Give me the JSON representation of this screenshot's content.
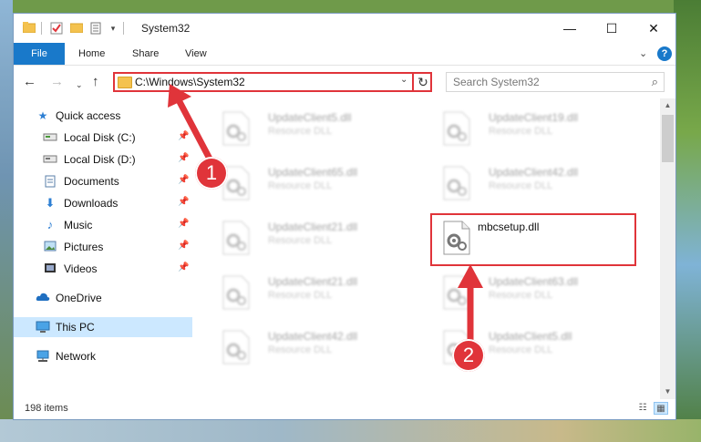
{
  "window": {
    "title": "System32",
    "controls": {
      "minimize": "—",
      "maximize": "☐",
      "close": "✕"
    },
    "quick_access_toolbar": [
      "folder-icon",
      "checklist-icon",
      "folder-icon",
      "properties-icon",
      "dropdown-icon"
    ]
  },
  "ribbon": {
    "file": "File",
    "tabs": [
      "Home",
      "Share",
      "View"
    ],
    "help": "?"
  },
  "navbar": {
    "address": "C:\\Windows\\System32",
    "search_placeholder": "Search System32"
  },
  "sidebar": {
    "items": [
      {
        "label": "Quick access",
        "icon": "star-icon"
      },
      {
        "label": "Local Disk (C:)",
        "icon": "drive-icon"
      },
      {
        "label": "Local Disk (D:)",
        "icon": "drive-icon"
      },
      {
        "label": "Documents",
        "icon": "documents-icon"
      },
      {
        "label": "Downloads",
        "icon": "download-icon"
      },
      {
        "label": "Music",
        "icon": "music-icon"
      },
      {
        "label": "Pictures",
        "icon": "pictures-icon"
      },
      {
        "label": "Videos",
        "icon": "videos-icon"
      },
      {
        "label": "OneDrive",
        "icon": "cloud-icon"
      },
      {
        "label": "This PC",
        "icon": "computer-icon",
        "selected": true
      },
      {
        "label": "Network",
        "icon": "network-icon"
      }
    ]
  },
  "files": {
    "type_label": "Resource DLL",
    "items": [
      {
        "name": "UpdateClient5.dll",
        "type": "Resource DLL"
      },
      {
        "name": "UpdateClient19.dll",
        "type": "Resource DLL"
      },
      {
        "name": "UpdateClient65.dll",
        "type": "Resource DLL"
      },
      {
        "name": "UpdateClient42.dll",
        "type": "Resource DLL"
      },
      {
        "name": "UpdateClient21.dll",
        "type": "Resource DLL"
      },
      {
        "name": "mbcsetup.dll",
        "type": ""
      },
      {
        "name": "UpdateClient21.dll",
        "type": "Resource DLL"
      },
      {
        "name": "UpdateClient63.dll",
        "type": "Resource DLL"
      },
      {
        "name": "UpdateClient42.dll",
        "type": "Resource DLL"
      },
      {
        "name": "UpdateClient5.dll",
        "type": "Resource DLL"
      }
    ]
  },
  "status": {
    "count": "198 items"
  },
  "annotations": {
    "step1": "1",
    "step2": "2",
    "color": "#e0343a"
  }
}
